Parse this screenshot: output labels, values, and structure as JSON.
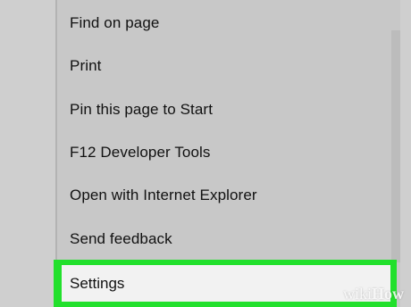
{
  "menu": {
    "items": [
      {
        "label": "Find on page"
      },
      {
        "label": "Print"
      },
      {
        "label": "Pin this page to Start"
      },
      {
        "label": "F12 Developer Tools"
      },
      {
        "label": "Open with Internet Explorer"
      },
      {
        "label": "Send feedback"
      }
    ],
    "settings_label": "Settings"
  },
  "colors": {
    "highlight": "#22e02c",
    "menu_bg": "#c8c8c8",
    "selected_bg": "#f2f2f2"
  },
  "watermark": {
    "prefix": "wiki",
    "suffix": "How"
  }
}
